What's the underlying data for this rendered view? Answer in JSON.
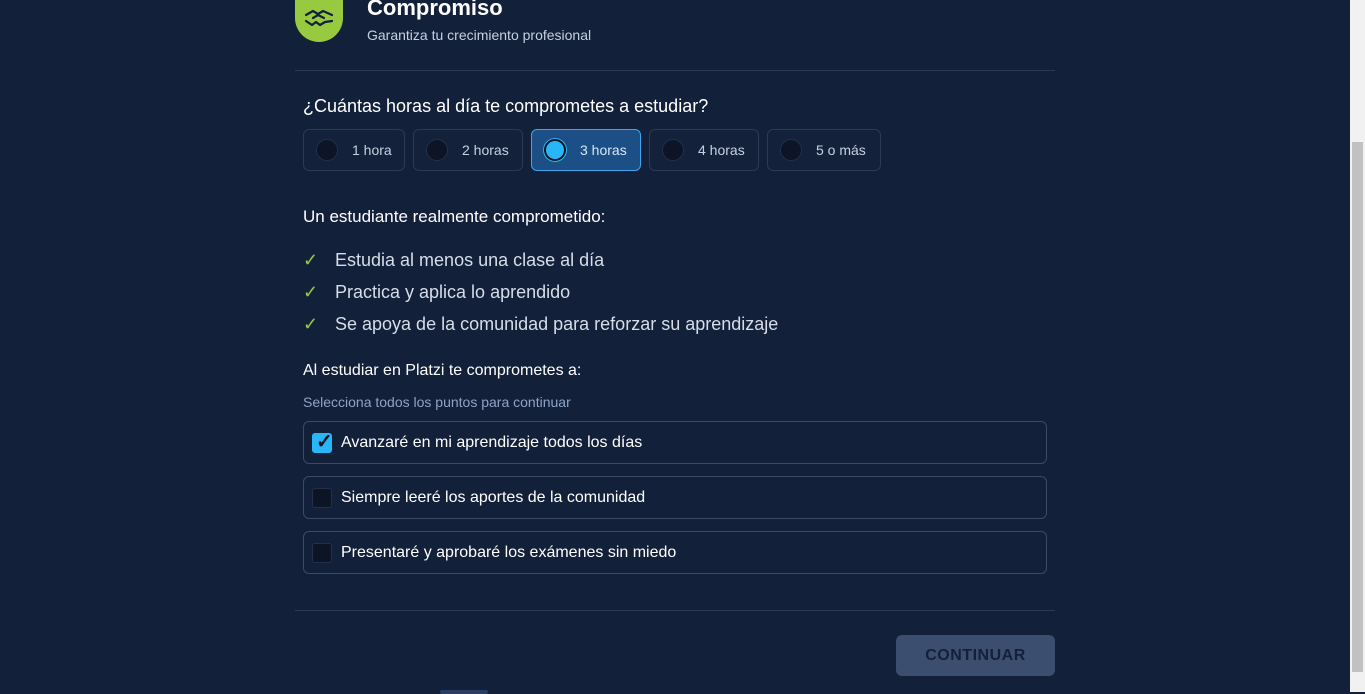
{
  "header": {
    "title": "Compromiso",
    "subtitle": "Garantiza tu crecimiento profesional",
    "logo_icon": "handshake-icon",
    "logo_color": "#98ca3f"
  },
  "hours": {
    "question": "¿Cuántas horas al día te comprometes a estudiar?",
    "options": [
      "1 hora",
      "2 horas",
      "3 horas",
      "4 horas",
      "5 o más"
    ],
    "selected": "3 horas"
  },
  "committed": {
    "title": "Un estudiante realmente comprometido:",
    "check_symbol": "✓",
    "items": [
      "Estudia al menos una clase al día",
      "Practica y aplica lo aprendido",
      "Se apoya de la comunidad para reforzar su aprendizaje"
    ]
  },
  "commitments": {
    "title": "Al estudiar en Platzi te comprometes a:",
    "hint": "Selecciona todos los puntos para continuar",
    "items": [
      {
        "label": "Avanzaré en mi aprendizaje todos los días",
        "checked": true
      },
      {
        "label": "Siempre leeré los aportes de la comunidad",
        "checked": false
      },
      {
        "label": "Presentaré y aprobaré los exámenes sin miedo",
        "checked": false
      }
    ]
  },
  "footer": {
    "continue_label": "CONTINUAR"
  },
  "colors": {
    "background": "#13203a",
    "accent": "#29b6f6",
    "check": "#98ca3f"
  }
}
